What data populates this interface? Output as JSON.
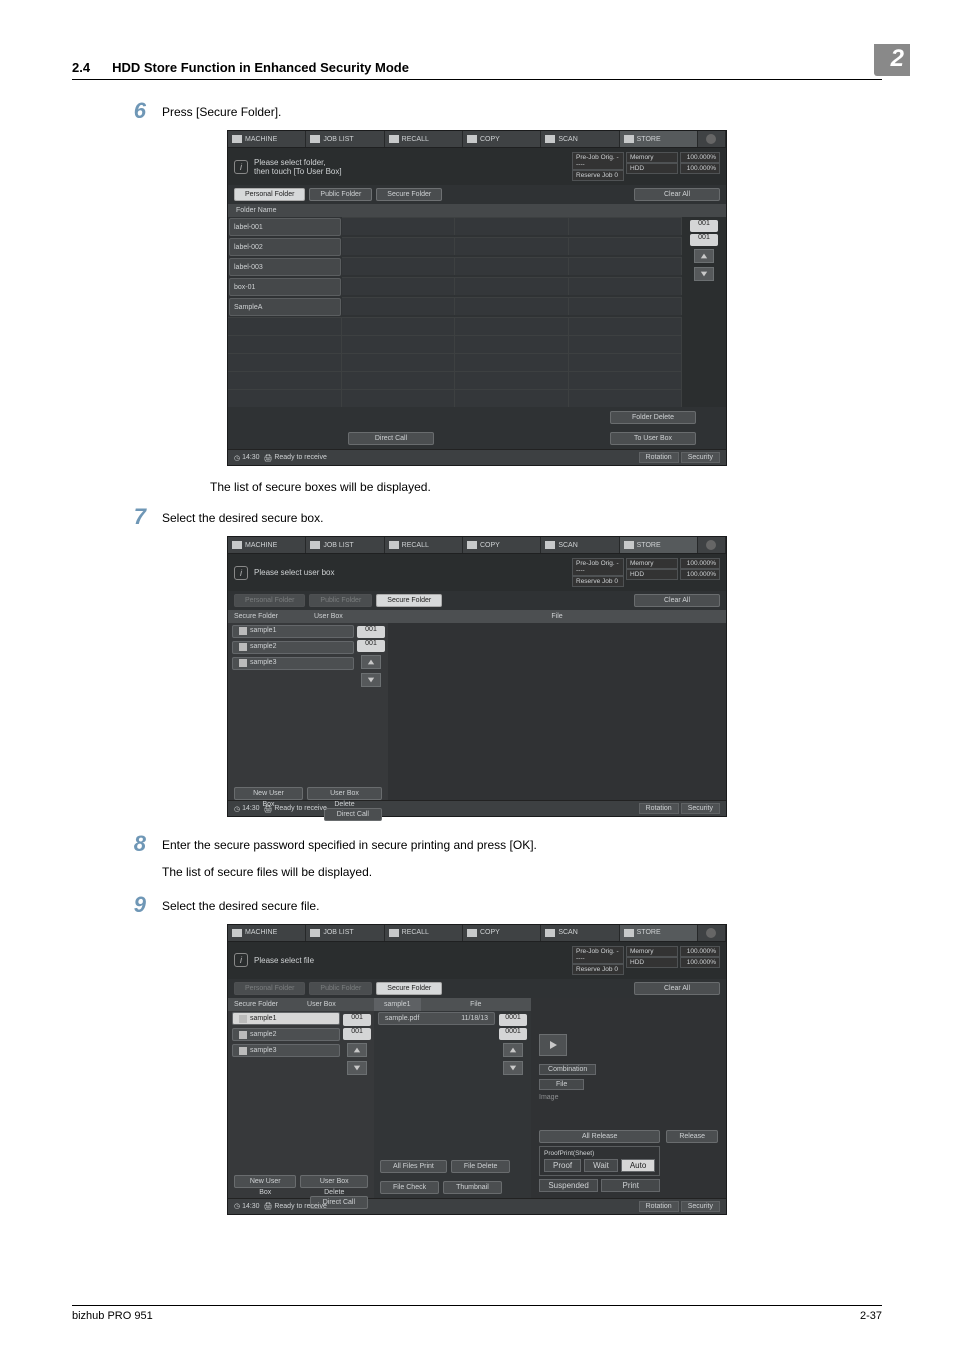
{
  "meta": {
    "section_number": "2.4",
    "section_title": "HDD Store Function in Enhanced Security Mode",
    "chapter": "2",
    "footer_left": "bizhub PRO 951",
    "footer_right": "2-37"
  },
  "steps": {
    "s6": {
      "num": "6",
      "text": "Press [Secure Folder].",
      "after": "The list of secure boxes will be displayed."
    },
    "s7": {
      "num": "7",
      "text": "Select the desired secure box."
    },
    "s8": {
      "num": "8",
      "text": "Enter the secure password specified in secure printing and press [OK].",
      "sub": "The list of secure files will be displayed."
    },
    "s9": {
      "num": "9",
      "text": "Select the desired secure file."
    }
  },
  "ui": {
    "tabs": [
      "MACHINE",
      "JOB LIST",
      "RECALL",
      "COPY",
      "SCAN",
      "STORE"
    ],
    "common": {
      "status_labels": {
        "prejob": "Pre-Job Orig.",
        "reserve": "Reserve Job",
        "memory": "Memory",
        "hdd": "HDD",
        "dashes": "-----",
        "zero": "0",
        "pct": "100.000%"
      },
      "folder_tabs": {
        "personal": "Personal Folder",
        "public": "Public Folder",
        "secure": "Secure Folder"
      },
      "clear_all": "Clear All",
      "direct_call": "Direct Call",
      "statusbar": {
        "time": "14:30",
        "ready": "Ready to receive",
        "rotation": "Rotation",
        "security": "Security"
      }
    },
    "shot1": {
      "msg": "Please select folder,\nthen touch [To User Box]",
      "header": "Folder Name",
      "rows": [
        "label-001",
        "label-002",
        "label-003",
        "box-01",
        "SampleA"
      ],
      "pager1": "001",
      "pager2": "001",
      "folder_delete": "Folder Delete",
      "to_user_box": "To User Box"
    },
    "shot2": {
      "msg": "Please select user box",
      "list_head": {
        "secure": "Secure Folder",
        "user": "User Box",
        "file": "File"
      },
      "rows": [
        "sample1",
        "sample2",
        "sample3"
      ],
      "pager1": "001",
      "pager2": "001",
      "new_user_box": "New User Box",
      "user_box_delete": "User Box Delete"
    },
    "shot3": {
      "msg": "Please select file",
      "rows": [
        "sample1",
        "sample2",
        "sample3"
      ],
      "filepanel_head": {
        "name": "sample1",
        "col": "File"
      },
      "file_row": {
        "name": "sample.pdf",
        "date": "11/18/13"
      },
      "pager1": "001",
      "pager2": "001",
      "fpager1": "0001",
      "fpager2": "0001",
      "mid": {
        "combination": "Combination",
        "file_btn": "File",
        "image": "Image"
      },
      "bottom_right": {
        "all_release": "All Release",
        "release": "Release",
        "group": "ProofPrint(Sheet)",
        "proof": "Proof",
        "wait": "Wait",
        "auto": "Auto",
        "suspended": "Suspended",
        "print": "Print"
      },
      "bottom_center": {
        "all_files_print": "All Files Print",
        "file_delete": "File Delete",
        "file_check": "File Check",
        "thumbnail": "Thumbnail"
      },
      "new_user_box": "New User Box",
      "user_box_delete": "User Box Delete"
    }
  }
}
